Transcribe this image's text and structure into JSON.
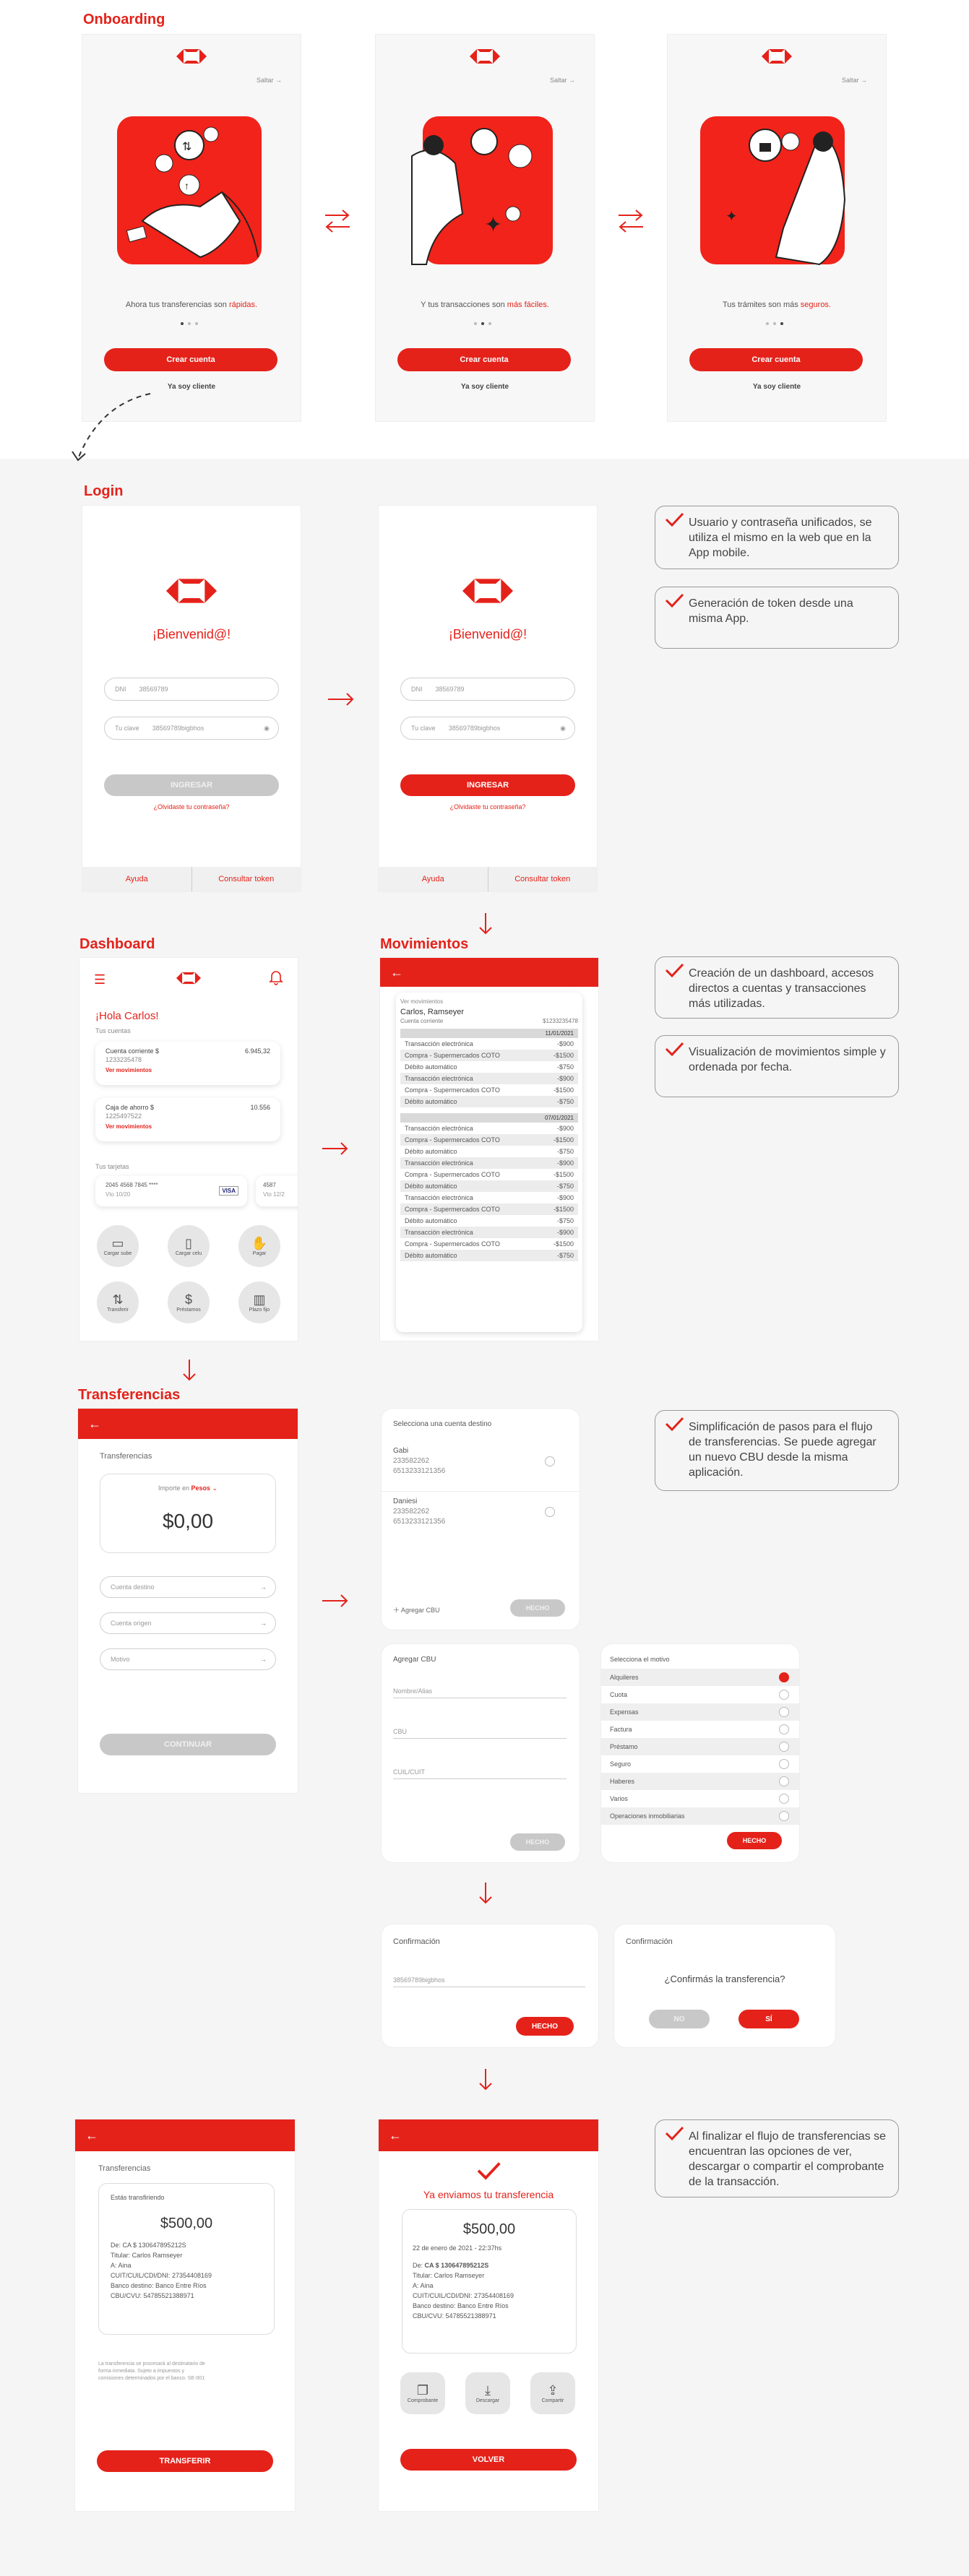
{
  "colors": {
    "brand": "#e4221a",
    "bg": "#f5f5f5"
  },
  "onboarding": {
    "title": "Onboarding",
    "skip": "Saltar",
    "screens": [
      {
        "text_a": "Ahora tus transferencias son ",
        "text_b": "rápidas."
      },
      {
        "text_a": "Y tus transacciones son ",
        "text_b": "más fáciles."
      },
      {
        "text_a": "Tus trámites son más ",
        "text_b": "seguros."
      }
    ],
    "create": "Crear cuenta",
    "client": "Ya soy cliente"
  },
  "login": {
    "title": "Login",
    "welcome": "¡Bienvenid@!",
    "dni_label": "DNI",
    "dni_value": "38569789",
    "pass_label": "Tu clave",
    "pass_value": "38569789bigbhos",
    "ingresar": "INGRESAR",
    "forgot": "¿Olvidaste tu contraseña?",
    "help": "Ayuda",
    "token": "Consultar token",
    "note1": "Usuario y contraseña unificados, se utiliza el mismo en la web que en la App mobile.",
    "note2": "Generación de token desde una misma App."
  },
  "dashboard": {
    "title": "Dashboard",
    "hello": "¡Hola Carlos!",
    "accounts_label": "Tus cuentas",
    "acc1_name": "Cuenta corriente $",
    "acc1_num": "1233235478",
    "acc1_amount": "6.945,32",
    "acc1_link": "Ver movimientos",
    "acc2_name": "Caja de ahorro $",
    "acc2_num": "1225497522",
    "acc2_amount": "10.556",
    "acc2_link": "Ver movimientos",
    "cards_label": "Tus tarjetas",
    "card1_num": "2045 4568 7845 ****",
    "card1_exp": "Vto 10/20",
    "card1_brand": "VISA",
    "card2_num": "4587",
    "card2_exp": "Vto 12/2",
    "actions": [
      "Cargar sube",
      "Cargar celu",
      "Pagar",
      "Transferir",
      "Préstamos",
      "Plazo fijo"
    ],
    "note1": "Creación de un dashboard, accesos directos a cuentas y transacciones más utilizadas.",
    "note2": "Visualización de movimientos simple y ordenada por fecha."
  },
  "movimientos": {
    "title": "Movimientos",
    "label": "Ver movimientos",
    "name": "Carlos, Ramseyer",
    "acc": "Cuenta corriente",
    "acc_num": "$1233235478",
    "date1": "11/01/2021",
    "rows1": [
      [
        "Transacción electrónica",
        "-$900"
      ],
      [
        "Compra - Supermercados COTO",
        "-$1500"
      ],
      [
        "Débito automático",
        "-$750"
      ],
      [
        "Transacción electrónica",
        "-$900"
      ],
      [
        "Compra - Supermercados COTO",
        "-$1500"
      ],
      [
        "Débito automático",
        "-$750"
      ]
    ],
    "date2": "07/01/2021",
    "rows2": [
      [
        "Transacción electrónica",
        "-$900"
      ],
      [
        "Compra - Supermercados COTO",
        "-$1500"
      ],
      [
        "Débito automático",
        "-$750"
      ],
      [
        "Transacción electrónica",
        "-$900"
      ],
      [
        "Compra - Supermercados COTO",
        "-$1500"
      ],
      [
        "Débito automático",
        "-$750"
      ],
      [
        "Transacción electrónica",
        "-$900"
      ],
      [
        "Compra - Supermercados COTO",
        "-$1500"
      ],
      [
        "Débito automático",
        "-$750"
      ],
      [
        "Transacción electrónica",
        "-$900"
      ],
      [
        "Compra - Supermercados COTO",
        "-$1500"
      ],
      [
        "Débito automático",
        "-$750"
      ]
    ]
  },
  "transfer": {
    "title": "Transferencias",
    "label": "Transferencias",
    "amount_label": "Importe en ",
    "currency": "Pesos",
    "amount": "$0,00",
    "dest": "Cuenta destino",
    "origin": "Cuenta origen",
    "motivo": "Motivo",
    "continue": "CONTINUAR",
    "select_dest": "Selecciona una cuenta destino",
    "c1_name": "Gabi",
    "c1_a": "233582262",
    "c1_b": "6513233121356",
    "c2_name": "Daniesi",
    "c2_a": "233582262",
    "c2_b": "6513233121356",
    "add_cbu": "Agregar CBU",
    "done": "HECHO",
    "cbu_title": "Agregar CBU",
    "cbu_name": "Nombre/Alias",
    "cbu": "CBU",
    "cuil": "CUIL/CUIT",
    "motivo_title": "Selecciona el motivo",
    "motivos": [
      "Alquileres",
      "Cuota",
      "Expensas",
      "Factura",
      "Préstamo",
      "Seguro",
      "Haberes",
      "Varios",
      "Operaciones inmobiliarias"
    ],
    "note": "Simplificación de pasos para el flujo de transferencias. Se puede agregar un nuevo CBU desde la misma aplicación.",
    "confirm_title": "Confirmación",
    "confirm_pass": "38569789bigbhos",
    "confirm_q": "¿Confirmás la transferencia?",
    "no": "NO",
    "yes": "SÍ"
  },
  "final": {
    "label": "Transferencias",
    "sending": "Estás transfiriendo",
    "amount": "$500,00",
    "from": "De: CA $ 130647895212S",
    "holder": "Titular: Carlos Ramseyer",
    "to": "A: Aina",
    "cuit": "CUIT/CUIL/CDI/DNI: 27354408169",
    "bank": "Banco destino: Banco Entre Ríos",
    "cbu": "CBU/CVU: 54785521388971",
    "legal": "La transferencia se procesará al destinatario de forma inmediata. Sujeto a impuestos y comisiones determinados por el banco. SE-001",
    "transfer_btn": "TRANSFERIR",
    "sent": "Ya enviamos tu transferencia",
    "date": "22 de enero de 2021 - 22:37hs",
    "from2": "CA $ 130647895212S",
    "from_prefix": "De: ",
    "actions": [
      "Comprobante",
      "Descargar",
      "Compartir"
    ],
    "back": "VOLVER",
    "note": "Al finalizar el flujo de transferencias se encuentran las opciones de ver, descargar o compartir el comprobante de la transacción."
  }
}
